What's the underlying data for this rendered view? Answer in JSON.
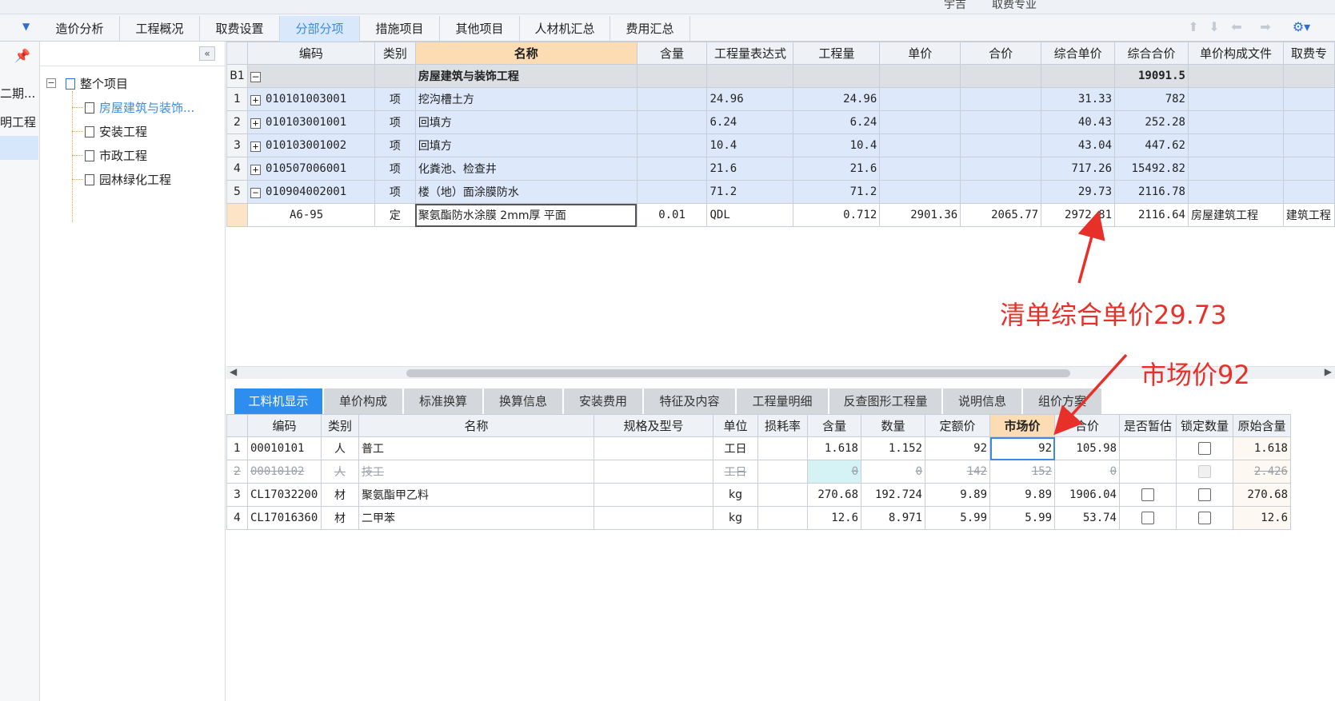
{
  "top_strip": {
    "left_text": "宇吉",
    "right_text": "取费专业"
  },
  "tabs": [
    {
      "label": "造价分析"
    },
    {
      "label": "工程概况"
    },
    {
      "label": "取费设置"
    },
    {
      "label": "分部分项"
    },
    {
      "label": "措施项目"
    },
    {
      "label": "其他项目"
    },
    {
      "label": "人材机汇总"
    },
    {
      "label": "费用汇总"
    }
  ],
  "left_rail": {
    "items": [
      "二期...",
      "明工程"
    ]
  },
  "tree": {
    "root": "整个项目",
    "children": [
      "房屋建筑与装饰...",
      "安装工程",
      "市政工程",
      "园林绿化工程"
    ]
  },
  "main_grid": {
    "headers": [
      "编码",
      "类别",
      "名称",
      "含量",
      "工程量表达式",
      "工程量",
      "单价",
      "合价",
      "综合单价",
      "综合合价",
      "单价构成文件",
      "取费专"
    ],
    "group": {
      "rn": "B1",
      "name": "房屋建筑与装饰工程",
      "total": "19091.5"
    },
    "rows": [
      {
        "rn": "1",
        "code": "010101003001",
        "type": "项",
        "name": "挖沟槽土方",
        "expr": "24.96",
        "qty": "24.96",
        "unit_total": "31.33",
        "total": "782"
      },
      {
        "rn": "2",
        "code": "010103001001",
        "type": "项",
        "name": "回填方",
        "expr": "6.24",
        "qty": "6.24",
        "unit_total": "40.43",
        "total": "252.28"
      },
      {
        "rn": "3",
        "code": "010103001002",
        "type": "项",
        "name": "回填方",
        "expr": "10.4",
        "qty": "10.4",
        "unit_total": "43.04",
        "total": "447.62"
      },
      {
        "rn": "4",
        "code": "010507006001",
        "type": "项",
        "name": "化粪池、检查井",
        "expr": "21.6",
        "qty": "21.6",
        "unit_total": "717.26",
        "total": "15492.82"
      },
      {
        "rn": "5",
        "code": "010904002001",
        "type": "项",
        "name": "楼（地）面涂膜防水",
        "expr": "71.2",
        "qty": "71.2",
        "unit_total": "29.73",
        "total": "2116.78"
      }
    ],
    "sub": {
      "code": "A6-95",
      "type": "定",
      "name": "聚氨酯防水涂膜 2mm厚 平面",
      "content": "0.01",
      "expr": "QDL",
      "qty": "0.712",
      "price": "2901.36",
      "amount": "2065.77",
      "unit_total": "2972.81",
      "total": "2116.64",
      "file": "房屋建筑工程",
      "fee": "建筑工程"
    }
  },
  "bottom_tabs": [
    "工料机显示",
    "单价构成",
    "标准换算",
    "换算信息",
    "安装费用",
    "特征及内容",
    "工程量明细",
    "反查图形工程量",
    "说明信息",
    "组价方案"
  ],
  "bottom_grid": {
    "headers": [
      "编码",
      "类别",
      "名称",
      "规格及型号",
      "单位",
      "损耗率",
      "含量",
      "数量",
      "定额价",
      "市场价",
      "合价",
      "是否暂估",
      "锁定数量",
      "原始含量"
    ],
    "rows": [
      {
        "rn": "1",
        "code": "00010101",
        "type": "人",
        "name": "普工",
        "unit": "工日",
        "content": "1.618",
        "count": "1.152",
        "quota": "92",
        "market": "92",
        "amount": "105.98",
        "orig": "1.618"
      },
      {
        "rn": "2",
        "code": "00010102",
        "type": "人",
        "name": "技工",
        "unit": "工日",
        "content": "0",
        "count": "0",
        "quota": "142",
        "market": "152",
        "amount": "0",
        "orig": "2.426"
      },
      {
        "rn": "3",
        "code": "CL17032200",
        "type": "材",
        "name": "聚氨酯甲乙料",
        "unit": "kg",
        "content": "270.68",
        "count": "192.724",
        "quota": "9.89",
        "market": "9.89",
        "amount": "1906.04",
        "orig": "270.68"
      },
      {
        "rn": "4",
        "code": "CL17016360",
        "type": "材",
        "name": "二甲苯",
        "unit": "kg",
        "content": "12.6",
        "count": "8.971",
        "quota": "5.99",
        "market": "5.99",
        "amount": "53.74",
        "orig": "12.6"
      }
    ]
  },
  "annotations": {
    "unit_price_note": "清单综合单价29.73",
    "market_price_note": "市场价92",
    "color": "#e8302a"
  }
}
